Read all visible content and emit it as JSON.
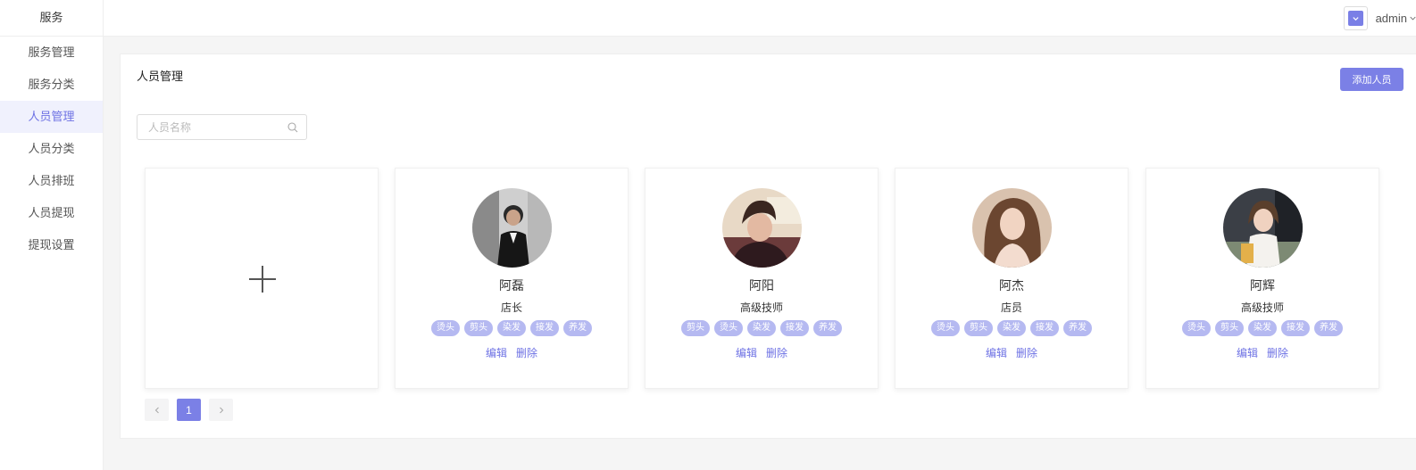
{
  "sidebar": {
    "title": "服务",
    "items": [
      {
        "label": "服务管理"
      },
      {
        "label": "服务分类"
      },
      {
        "label": "人员管理"
      },
      {
        "label": "人员分类"
      },
      {
        "label": "人员排班"
      },
      {
        "label": "人员提现"
      },
      {
        "label": "提现设置"
      }
    ],
    "active_index": 2
  },
  "header": {
    "user_name": "admin",
    "avatar_icon": "chevron-down-icon",
    "accent": "#7a7fe6"
  },
  "main": {
    "title": "人员管理",
    "add_button": "添加人员",
    "search": {
      "placeholder": "人员名称",
      "value": ""
    },
    "add_card_icon": "plus-icon",
    "staff": [
      {
        "name": "阿磊",
        "role": "店长",
        "tags": [
          "烫头",
          "剪头",
          "染发",
          "接发",
          "养发"
        ],
        "edit": "编辑",
        "delete": "删除"
      },
      {
        "name": "阿阳",
        "role": "高级技师",
        "tags": [
          "剪头",
          "烫头",
          "染发",
          "接发",
          "养发"
        ],
        "edit": "编辑",
        "delete": "删除"
      },
      {
        "name": "阿杰",
        "role": "店员",
        "tags": [
          "烫头",
          "剪头",
          "染发",
          "接发",
          "养发"
        ],
        "edit": "编辑",
        "delete": "删除"
      },
      {
        "name": "阿辉",
        "role": "高级技师",
        "tags": [
          "烫头",
          "剪头",
          "染发",
          "接发",
          "养发"
        ],
        "edit": "编辑",
        "delete": "删除"
      }
    ]
  },
  "pagination": {
    "current": "1",
    "prev_icon": "chevron-left-icon",
    "next_icon": "chevron-right-icon"
  },
  "colors": {
    "primary": "#7b80e6",
    "tag_bg": "#b5b9f1",
    "link": "#6e72e4"
  }
}
